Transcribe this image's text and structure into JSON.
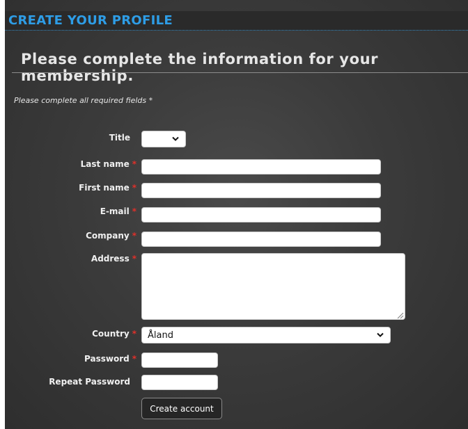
{
  "header": {
    "title": "CREATE YOUR PROFILE"
  },
  "intro": {
    "subtitle": "Please complete the information for your membership.",
    "required_note": "Please complete all required fields *"
  },
  "form": {
    "required_marker": "*",
    "title": {
      "label": "Title",
      "value": ""
    },
    "last_name": {
      "label": "Last name",
      "value": ""
    },
    "first_name": {
      "label": "First name",
      "value": ""
    },
    "email": {
      "label": "E-mail",
      "value": ""
    },
    "company": {
      "label": "Company",
      "value": ""
    },
    "address": {
      "label": "Address",
      "value": ""
    },
    "country": {
      "label": "Country",
      "value": "Åland"
    },
    "password": {
      "label": "Password",
      "value": ""
    },
    "repeat_password": {
      "label": "Repeat Password",
      "value": ""
    },
    "submit_label": "Create account"
  },
  "colors": {
    "header_accent": "#2e9de6",
    "required_marker": "#e0302a",
    "panel_background": "#3b3b3b"
  },
  "icons": {
    "select_arrow": "chevron-down-icon",
    "resize": "resize-grip-icon"
  }
}
